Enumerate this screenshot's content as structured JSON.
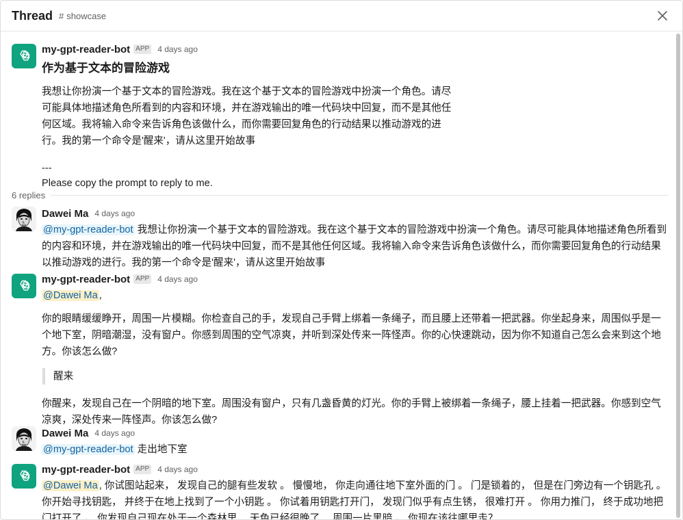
{
  "header": {
    "title": "Thread",
    "channel_hash": "#",
    "channel": "showcase"
  },
  "icons": {
    "close": "close-icon",
    "bot_avatar": "openai-logo-icon",
    "user_avatar": "user-portrait-icon"
  },
  "colors": {
    "bot_avatar_bg": "#10a37f",
    "mention_bg": "#e8f5fa",
    "mention_text": "#1264a3",
    "self_mention_bg": "#fcefc7"
  },
  "root": {
    "name": "my-gpt-reader-bot",
    "badge": "APP",
    "time": "4 days ago",
    "heading": "作为基于文本的冒险游戏",
    "para1": "我想让你扮演一个基于文本的冒险游戏。我在这个基于文本的冒险游戏中扮演一个角色。请尽可能具体地描述角色所看到的内容和环境，并在游戏输出的唯一代码块中回复，而不是其他任何区域。我将输入命令来告诉角色该做什么，而你需要回复角色的行动结果以推动游戏的进行。我的第一个命令是'醒来'，请从这里开始故事",
    "separator": "---",
    "para2": "Please copy the prompt to reply to me."
  },
  "replies_label": "6 replies",
  "messages": [
    {
      "name": "Dawei Ma",
      "time": "4 days ago",
      "mention": "@my-gpt-reader-bot",
      "text": " 我想让你扮演一个基于文本的冒险游戏。我在这个基于文本的冒险游戏中扮演一个角色。请尽可能具体地描述角色所看到的内容和环境，并在游戏输出的唯一代码块中回复，而不是其他任何区域。我将输入命令来告诉角色该做什么，而你需要回复角色的行动结果以推动游戏的进行。我的第一个命令是'醒来'，请从这里开始故事"
    },
    {
      "name": "my-gpt-reader-bot",
      "badge": "APP",
      "time": "4 days ago",
      "mention": "@Dawei Ma",
      "mention_suffix": ",",
      "para1": "你的眼睛缓缓睁开，周围一片模糊。你检查自己的手，发现自己手臂上绑着一条绳子，而且腰上还带着一把武器。你坐起身来，周围似乎是一个地下室，阴暗潮湿，没有窗户。你感到周围的空气凉爽，并听到深处传来一阵怪声。你的心快速跳动，因为你不知道自己怎么会来到这个地方。你该怎么做?",
      "quote": "醒来",
      "para2": "你醒来，发现自己在一个阴暗的地下室。周围没有窗户，只有几盏昏黄的灯光。你的手臂上被绑着一条绳子，腰上挂着一把武器。你感到空气凉爽，深处传来一阵怪声。你该怎么做?"
    },
    {
      "name": "Dawei Ma",
      "time": "4 days ago",
      "mention": "@my-gpt-reader-bot",
      "text": " 走出地下室"
    },
    {
      "name": "my-gpt-reader-bot",
      "badge": "APP",
      "time": "4 days ago",
      "mention": "@Dawei Ma",
      "text": ", 你试图站起来， 发现自己的腿有些发软 。 慢慢地， 你走向通往地下室外面的门 。 门是锁着的， 但是在门旁边有一个钥匙孔 。 你开始寻找钥匙， 并终于在地上找到了一个小钥匙 。 你试着用钥匙打开门， 发现门似乎有点生锈， 很难打开 。 你用力推门， 终于成功地把门打开了 。 你发现自己现在处于一个森林里， 天色已经很晚了， 周围一片黑暗 。 你现在该往哪里走？"
    }
  ]
}
